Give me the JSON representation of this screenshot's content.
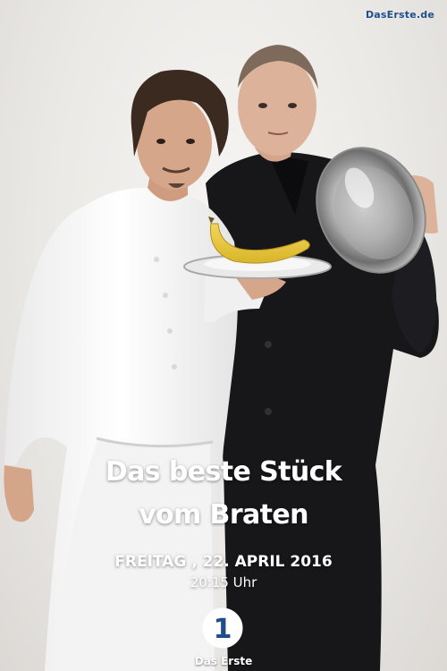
{
  "poster": {
    "brand_top": "DasErste.de",
    "title_line_1": "Das beste Stück",
    "title_line_2": "vom Braten",
    "date": "FREITAG , 22. APRIL 2016",
    "time": "20:15 Uhr",
    "logo_number": "1",
    "logo_label": "Das Erste"
  },
  "colors": {
    "background": "#ebe9e6",
    "brand_blue": "#1f4e8c",
    "text": "#ffffff"
  }
}
